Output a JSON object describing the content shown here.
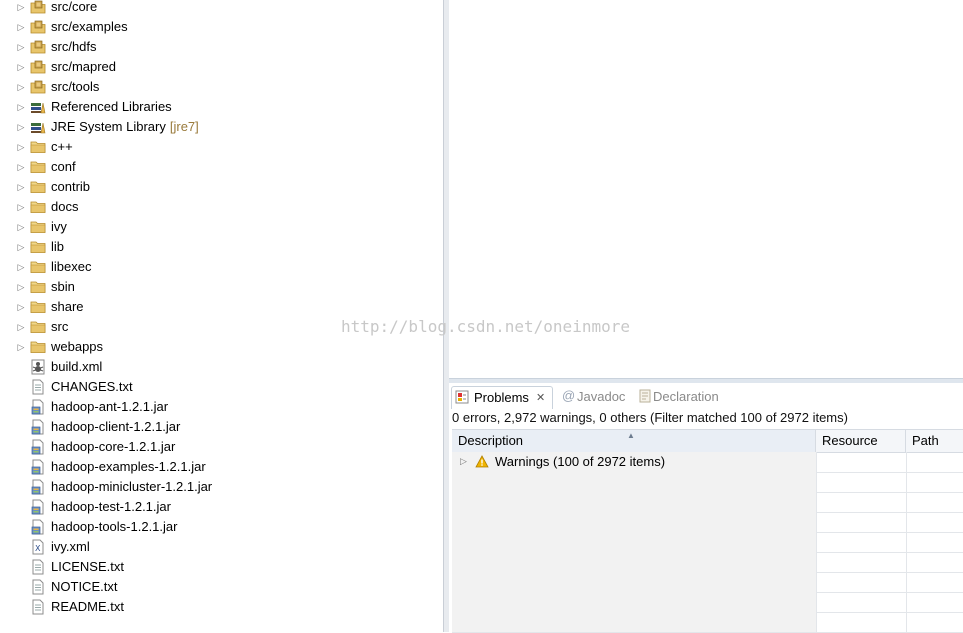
{
  "explorer": {
    "items": [
      {
        "label": "src/core",
        "type": "source-folder",
        "expandable": true
      },
      {
        "label": "src/examples",
        "type": "source-folder",
        "expandable": true
      },
      {
        "label": "src/hdfs",
        "type": "source-folder",
        "expandable": true
      },
      {
        "label": "src/mapred",
        "type": "source-folder",
        "expandable": true
      },
      {
        "label": "src/tools",
        "type": "source-folder",
        "expandable": true
      },
      {
        "label": "Referenced Libraries",
        "type": "library",
        "expandable": true
      },
      {
        "label": "JRE System Library",
        "decoration": "[jre7]",
        "type": "library",
        "expandable": true
      },
      {
        "label": "c++",
        "type": "folder",
        "expandable": true
      },
      {
        "label": "conf",
        "type": "folder",
        "expandable": true
      },
      {
        "label": "contrib",
        "type": "folder",
        "expandable": true
      },
      {
        "label": "docs",
        "type": "folder",
        "expandable": true
      },
      {
        "label": "ivy",
        "type": "folder",
        "expandable": true
      },
      {
        "label": "lib",
        "type": "folder",
        "expandable": true
      },
      {
        "label": "libexec",
        "type": "folder",
        "expandable": true
      },
      {
        "label": "sbin",
        "type": "folder",
        "expandable": true
      },
      {
        "label": "share",
        "type": "folder",
        "expandable": true
      },
      {
        "label": "src",
        "type": "folder",
        "expandable": true
      },
      {
        "label": "webapps",
        "type": "folder",
        "expandable": true
      },
      {
        "label": "build.xml",
        "type": "ant-file",
        "expandable": false
      },
      {
        "label": "CHANGES.txt",
        "type": "text-file",
        "expandable": false
      },
      {
        "label": "hadoop-ant-1.2.1.jar",
        "type": "jar-file",
        "expandable": false
      },
      {
        "label": "hadoop-client-1.2.1.jar",
        "type": "jar-file",
        "expandable": false
      },
      {
        "label": "hadoop-core-1.2.1.jar",
        "type": "jar-file",
        "expandable": false
      },
      {
        "label": "hadoop-examples-1.2.1.jar",
        "type": "jar-file",
        "expandable": false
      },
      {
        "label": "hadoop-minicluster-1.2.1.jar",
        "type": "jar-file",
        "expandable": false
      },
      {
        "label": "hadoop-test-1.2.1.jar",
        "type": "jar-file",
        "expandable": false
      },
      {
        "label": "hadoop-tools-1.2.1.jar",
        "type": "jar-file",
        "expandable": false
      },
      {
        "label": "ivy.xml",
        "type": "xml-file",
        "expandable": false
      },
      {
        "label": "LICENSE.txt",
        "type": "text-file",
        "expandable": false
      },
      {
        "label": "NOTICE.txt",
        "type": "text-file",
        "expandable": false
      },
      {
        "label": "README.txt",
        "type": "text-file",
        "expandable": false
      }
    ]
  },
  "watermark": "http://blog.csdn.net/oneinmore",
  "panel": {
    "tabs": {
      "problems": "Problems",
      "javadoc": "Javadoc",
      "declaration": "Declaration"
    },
    "summary": "0 errors, 2,972 warnings, 0 others (Filter matched 100 of 2972 items)",
    "columns": {
      "description": "Description",
      "resource": "Resource",
      "path": "Path"
    },
    "warnings_row": "Warnings (100 of 2972 items)"
  },
  "colors": {
    "folder": "#e8c56b",
    "warning": "#f0b400",
    "accent": "#3b6bb5"
  }
}
